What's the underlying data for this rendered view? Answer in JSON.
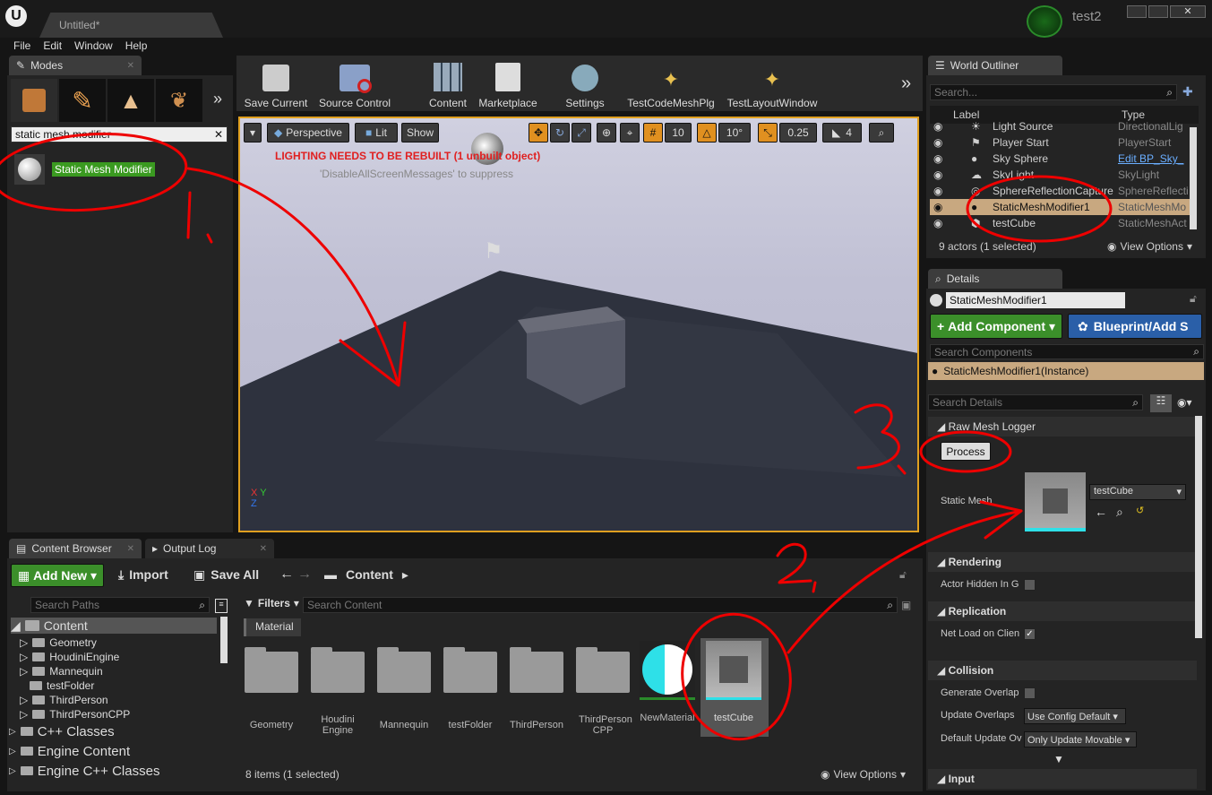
{
  "window": {
    "tab": "Untitled*",
    "project": "test2"
  },
  "menu": [
    "File",
    "Edit",
    "Window",
    "Help"
  ],
  "modes": {
    "tab": "Modes",
    "search_value": "static mesh modifier",
    "result": "Static Mesh Modifier"
  },
  "toolbar": {
    "save": "Save Current",
    "source": "Source Control",
    "content": "Content",
    "market": "Marketplace",
    "settings": "Settings",
    "plugin1": "TestCodeMeshPlg",
    "plugin2": "TestLayoutWindow"
  },
  "viewport": {
    "perspective": "Perspective",
    "lit": "Lit",
    "show": "Show",
    "grid": "10",
    "rot": "10°",
    "scale": "0.25",
    "cam": "4",
    "warning": "LIGHTING NEEDS TO BE REBUILT (1 unbuilt object)",
    "suppress": "'DisableAllScreenMessages' to suppress"
  },
  "outliner": {
    "tab": "World Outliner",
    "search": "Search...",
    "col_label": "Label",
    "col_type": "Type",
    "rows": [
      {
        "label": "Light Source",
        "type": "DirectionalLig"
      },
      {
        "label": "Player Start",
        "type": "PlayerStart"
      },
      {
        "label": "Sky Sphere",
        "type": "Edit BP_Sky_"
      },
      {
        "label": "SkyLight",
        "type": "SkyLight"
      },
      {
        "label": "SphereReflectionCapture",
        "type": "SphereReflecti"
      },
      {
        "label": "StaticMeshModifier1",
        "type": "StaticMeshMo"
      },
      {
        "label": "testCube",
        "type": "StaticMeshAct"
      }
    ],
    "footer": "9 actors (1 selected)",
    "view_options": "View Options"
  },
  "details": {
    "tab": "Details",
    "name": "StaticMeshModifier1",
    "add_component": "Add Component",
    "blueprint": "Blueprint/Add S",
    "search_components": "Search Components",
    "instance": "StaticMeshModifier1(Instance)",
    "search_details": "Search Details",
    "section1": "Raw Mesh Logger",
    "process": "Process",
    "static_mesh_label": "Static Mesh",
    "mesh_value": "testCube",
    "rendering": "Rendering",
    "actor_hidden": "Actor Hidden In G",
    "replication": "Replication",
    "net_load": "Net Load on Clien",
    "collision": "Collision",
    "gen_overlap": "Generate Overlap",
    "update_overlaps": "Update Overlaps",
    "update_overlaps_value": "Use Config Default",
    "default_update": "Default Update Ov",
    "default_update_value": "Only Update Movable",
    "input": "Input"
  },
  "content_browser": {
    "tab": "Content Browser",
    "output_tab": "Output Log",
    "add_new": "Add New",
    "import": "Import",
    "save_all": "Save All",
    "path": "Content",
    "search_paths": "Search Paths",
    "filters": "Filters",
    "search_content": "Search Content",
    "filter_chip": "Material",
    "tree": [
      {
        "name": "Content"
      },
      {
        "name": "Geometry"
      },
      {
        "name": "HoudiniEngine"
      },
      {
        "name": "Mannequin"
      },
      {
        "name": "testFolder"
      },
      {
        "name": "ThirdPerson"
      },
      {
        "name": "ThirdPersonCPP"
      },
      {
        "name": "C++ Classes"
      },
      {
        "name": "Engine Content"
      },
      {
        "name": "Engine C++ Classes"
      }
    ],
    "assets": [
      "Geometry",
      "Houdini Engine",
      "Mannequin",
      "testFolder",
      "ThirdPerson",
      "ThirdPerson CPP",
      "NewMaterial",
      "testCube"
    ],
    "footer": "8 items (1 selected)",
    "view_options": "View Options"
  },
  "annotations": {
    "one": "1.",
    "two": "2,",
    "three": "3."
  }
}
